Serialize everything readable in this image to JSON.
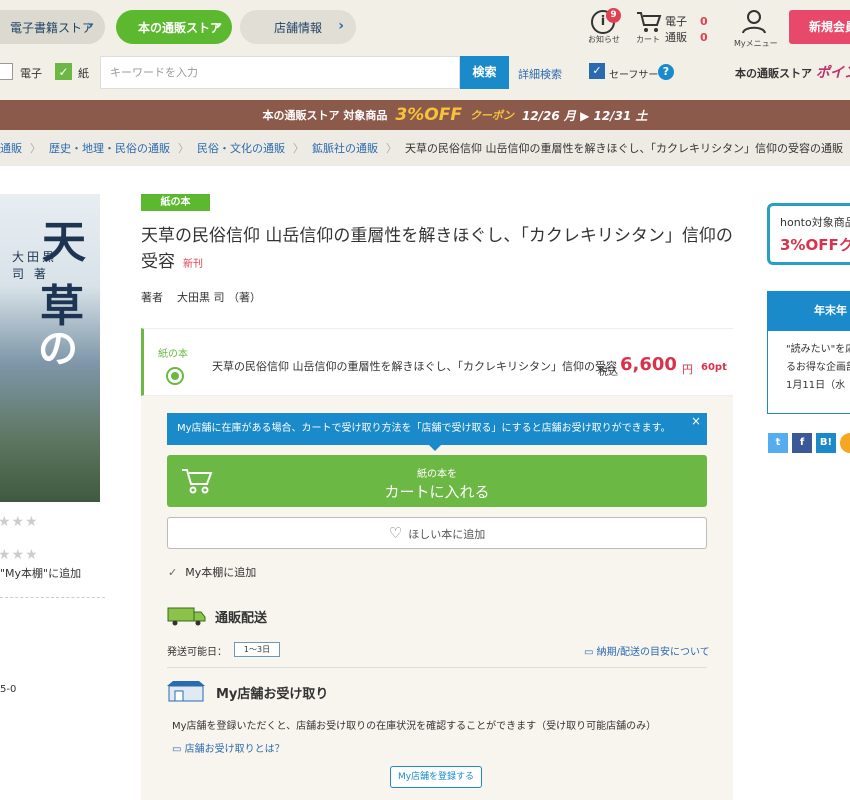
{
  "header": {
    "tabs": [
      {
        "label": "電子書籍ストア"
      },
      {
        "label": "本の通販ストア"
      },
      {
        "label": "店舗情報"
      }
    ],
    "info_label": "お知らせ",
    "info_badge": "9",
    "cart_label": "カート",
    "cart_rows": [
      {
        "label": "電子",
        "count": "0"
      },
      {
        "label": "通販",
        "count": "0"
      }
    ],
    "mymenu_label": "Myメニュー",
    "register_label": "新規会員"
  },
  "search": {
    "ebook_label": "電子",
    "paper_label": "紙",
    "placeholder": "キーワードを入力",
    "search_button": "検索",
    "advanced_link": "詳細検索",
    "safe_search_label": "セーフサーチ",
    "help_icon_label": "?",
    "point_text_prefix": "本の通販ストア",
    "point_text_em": "ポイン"
  },
  "promo": {
    "prefix": "本の通販ストア 対象商品",
    "offer": "3%OFF",
    "coupon": "クーポン",
    "dates": "12/26 月 ▶ 12/31 土"
  },
  "breadcrumb": [
    "通販",
    "歴史・地理・民俗の通販",
    "民俗・文化の通販",
    "鉱脈社の通販",
    "天草の民俗信仰 山岳信仰の重層性を解きほぐし、「カクレキリシタン」信仰の受容の通販"
  ],
  "cover": {
    "title_chars": [
      "天",
      "草",
      "の"
    ],
    "author": "大田黒 司 著"
  },
  "left": {
    "bookshelf_note": "\"My本棚\"に追加",
    "isbn_fragment": "5-0"
  },
  "product": {
    "format_tag": "紙の本",
    "title": "天草の民俗信仰 山岳信仰の重層性を解きほぐし、「カクレキリシタン」信仰の受容",
    "new_label": "新刊",
    "author_role": "著者",
    "author_name": "大田黒 司 （著）"
  },
  "buy": {
    "format_label": "紙の本",
    "item_title": "天草の民俗信仰 山岳信仰の重層性を解きほぐし、「カクレキリシタン」信仰の受容",
    "tax_label": "税込",
    "price": "6,600",
    "currency": "円",
    "points": "60pt",
    "notice": "My店舗に在庫がある場合、カートで受け取り方法を「店舗で受け取る」にすると店舗お受け取りができます。",
    "cart_line1": "紙の本を",
    "cart_line2": "カートに入れる",
    "wishlist": "ほしい本に追加",
    "bookshelf": "My本棚に追加"
  },
  "shipping": {
    "title": "通販配送",
    "ship_label": "発送可能日：",
    "days": "1〜3日",
    "delivery_link": "納期/配送の目安について"
  },
  "store_pickup": {
    "title": "My店舗お受け取り",
    "description": "My店舗を登録いただくと、店舗お受け取りの在庫状況を確認することができます（受け取り可能店舗のみ）",
    "link": "店舗お受け取りとは？",
    "register_button": "My店舗を登録する"
  },
  "sidebar": {
    "coupon_line1": "honto対象商品",
    "coupon_line2": "3%OFFク",
    "banner": "年末年",
    "text_lines": [
      "\"読みたい\"を応",
      "るお得な企画部",
      "1月11日（水"
    ],
    "share": [
      "t",
      "f",
      "B!"
    ]
  },
  "colors": {
    "green": "#6cb845",
    "blue": "#1a8acb",
    "price_red": "#d8334a",
    "promo_bg": "#8c5a4a"
  }
}
